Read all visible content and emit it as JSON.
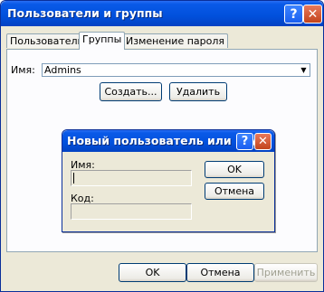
{
  "window": {
    "title": "Пользователи и группы",
    "help_icon": "?",
    "close_icon": "✕"
  },
  "tabs": [
    {
      "label": "Пользователи",
      "active": false
    },
    {
      "label": "Группы",
      "active": true
    },
    {
      "label": "Изменение пароля",
      "active": false
    }
  ],
  "groups_tab": {
    "name_label": "Имя:",
    "name_value": "Admins",
    "create_button": "Создать...",
    "delete_button": "Удалить"
  },
  "dialog": {
    "title": "Новый пользователь или гру...",
    "help_icon": "?",
    "close_icon": "✕",
    "name_label": "Имя:",
    "name_value": "",
    "code_label": "Код:",
    "code_value": "",
    "ok_button": "OK",
    "cancel_button": "Отмена"
  },
  "footer": {
    "ok_button": "OK",
    "cancel_button": "Отмена",
    "apply_button": "Применить"
  }
}
